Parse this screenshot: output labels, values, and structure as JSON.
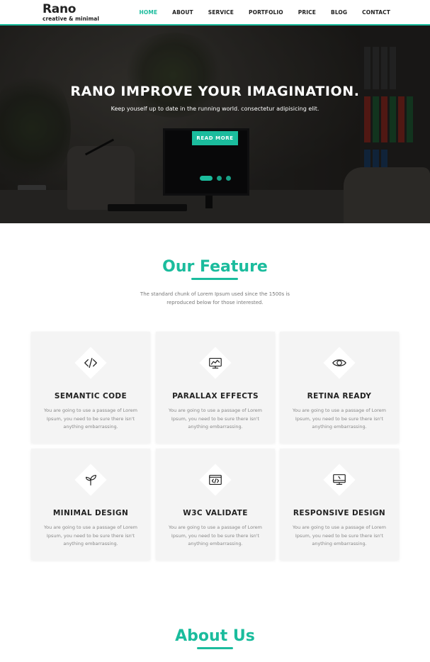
{
  "header": {
    "logo_title": "Rano",
    "logo_subtitle": "creative & minimal",
    "nav": [
      {
        "label": "HOME",
        "active": true
      },
      {
        "label": "ABOUT",
        "active": false
      },
      {
        "label": "SERVICE",
        "active": false
      },
      {
        "label": "PORTFOLIO",
        "active": false
      },
      {
        "label": "PRICE",
        "active": false
      },
      {
        "label": "BLOG",
        "active": false
      },
      {
        "label": "CONTACT",
        "active": false
      }
    ]
  },
  "hero": {
    "title": "RANO IMPROVE YOUR IMAGINATION.",
    "subtitle": "Keep youself up to date in the running world. consectetur adipisicing elit.",
    "button_label": "READ MORE",
    "slider_dots": 3,
    "active_dot": 1
  },
  "features": {
    "title": "Our Feature",
    "description": "The standard chunk of Lorem Ipsum used since the 1500s is reproduced below for those interested.",
    "cards": [
      {
        "icon": "code-icon",
        "title": "SEMANTIC CODE",
        "text": "You are going to use a passage of Lorem Ipsum, you need to be sure there isn't anything embarrassing."
      },
      {
        "icon": "monitor-chart-icon",
        "title": "PARALLAX EFFECTS",
        "text": "You are going to use a passage of Lorem Ipsum, you need to be sure there isn't anything embarrassing."
      },
      {
        "icon": "eye-icon",
        "title": "RETINA READY",
        "text": "You are going to use a passage of Lorem Ipsum, you need to be sure there isn't anything embarrassing."
      },
      {
        "icon": "sprout-icon",
        "title": "MINIMAL DESIGN",
        "text": "You are going to use a passage of Lorem Ipsum, you need to be sure there isn't anything embarrassing."
      },
      {
        "icon": "browser-code-icon",
        "title": "W3C VALIDATE",
        "text": "You are going to use a passage of Lorem Ipsum, you need to be sure there isn't anything embarrassing."
      },
      {
        "icon": "desktop-icon",
        "title": "RESPONSIVE DESIGN",
        "text": "You are going to use a passage of Lorem Ipsum, you need to be sure there isn't anything embarrassing."
      }
    ]
  },
  "about": {
    "title": "About Us"
  },
  "colors": {
    "accent": "#1bbc9d",
    "card_bg": "#f4f4f4",
    "text_dark": "#222222",
    "text_muted": "#888888"
  }
}
